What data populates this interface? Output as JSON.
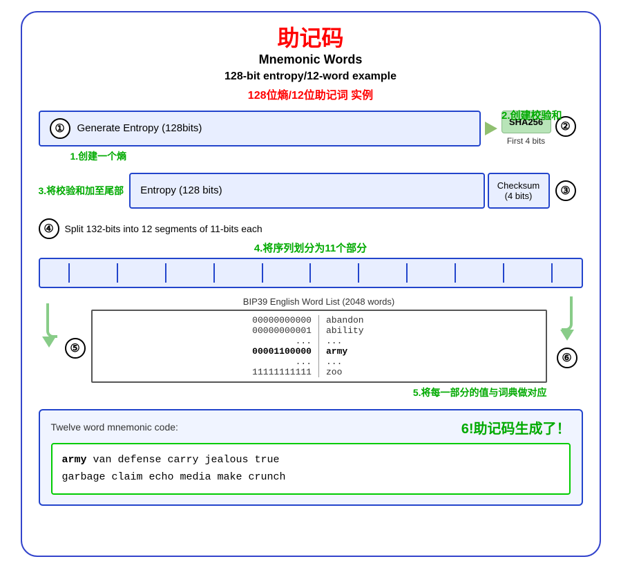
{
  "title": {
    "cn": "助记码",
    "en_line1": "Mnemonic Words",
    "en_line2": "128-bit entropy/12-word example",
    "cn_sub": "128位熵/12位助记词 实例"
  },
  "annotations": {
    "step1_cn": "1.创建一个熵",
    "step2_cn": "2.创建校验和",
    "step3_cn": "3.将校验和加至尾部",
    "step4_cn": "4.将序列划分为11个部分",
    "step5_cn": "5.将每一部分的值与词典做对应",
    "step6_cn": "6!助记码生成了！"
  },
  "step1": {
    "circle": "①",
    "label": "Generate Entropy (128bits)"
  },
  "step2": {
    "circle": "②",
    "sha256": "SHA256",
    "first4bits": "First 4 bits"
  },
  "step3": {
    "entropy_label": "Entropy (128 bits)",
    "checksum_label": "Checksum",
    "checksum_bits": "(4 bits)",
    "circle": "③"
  },
  "step4": {
    "circle": "④",
    "label": "Split 132-bits into 12 segments of 11-bits each"
  },
  "step5": {
    "circle": "⑤",
    "wordlist_title": "BIP39 English Word List (2048 words)",
    "words": [
      {
        "bin": "00000000000",
        "word": "abandon"
      },
      {
        "bin": "00000000001",
        "word": "ability"
      },
      {
        "bin": "...",
        "word": "..."
      },
      {
        "bin": "00001100000",
        "word": "army",
        "highlight": true
      },
      {
        "bin": "...",
        "word": "..."
      },
      {
        "bin": "11111111111",
        "word": "zoo"
      }
    ]
  },
  "step6": {
    "circle": "⑥",
    "twelve_word_label": "Twelve word mnemonic code:",
    "mnemonic": "army van defense carry jealous true garbage claim echo media make crunch",
    "mnemonic_first": "army",
    "mnemonic_rest": " van defense carry jealous true\ngarbage claim echo media make crunch"
  },
  "segments_count": 12
}
